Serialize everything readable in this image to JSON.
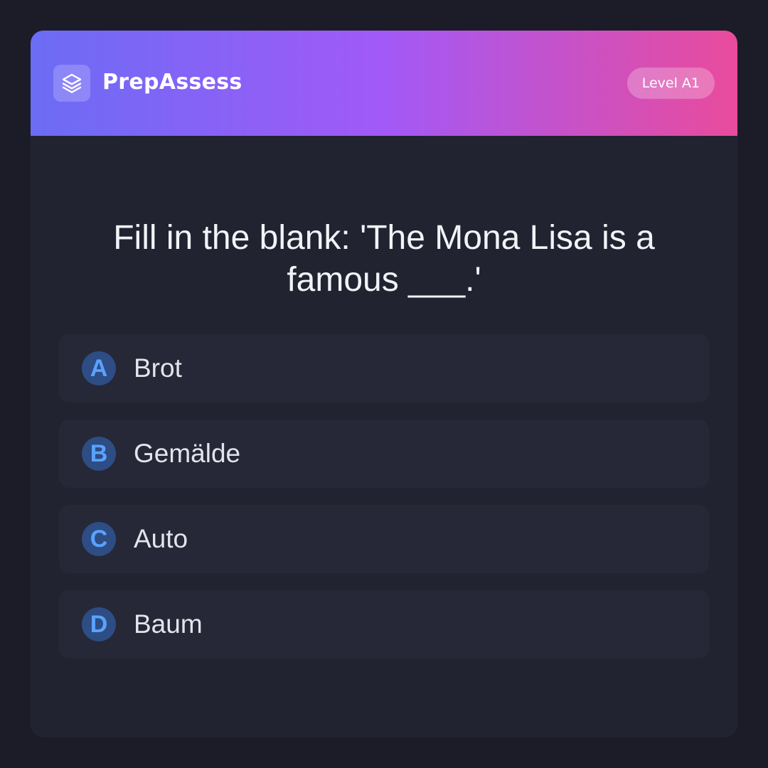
{
  "header": {
    "logo_icon": "layers-icon",
    "brand": "PrepAssess",
    "level": "Level A1"
  },
  "question": {
    "text": "Fill in the blank: 'The Mona Lisa is a famous ___.'"
  },
  "options": [
    {
      "letter": "A",
      "text": "Brot"
    },
    {
      "letter": "B",
      "text": "Gemälde"
    },
    {
      "letter": "C",
      "text": "Auto"
    },
    {
      "letter": "D",
      "text": "Baum"
    }
  ],
  "colors": {
    "background": "#1b1c27",
    "card": "#212331",
    "option_bg": "#262837",
    "header_gradient": [
      "#6b6cf5",
      "#a259f7",
      "#e94b9c"
    ],
    "letter_badge": "#2d4d84",
    "letter_text": "#5aa2ff"
  }
}
